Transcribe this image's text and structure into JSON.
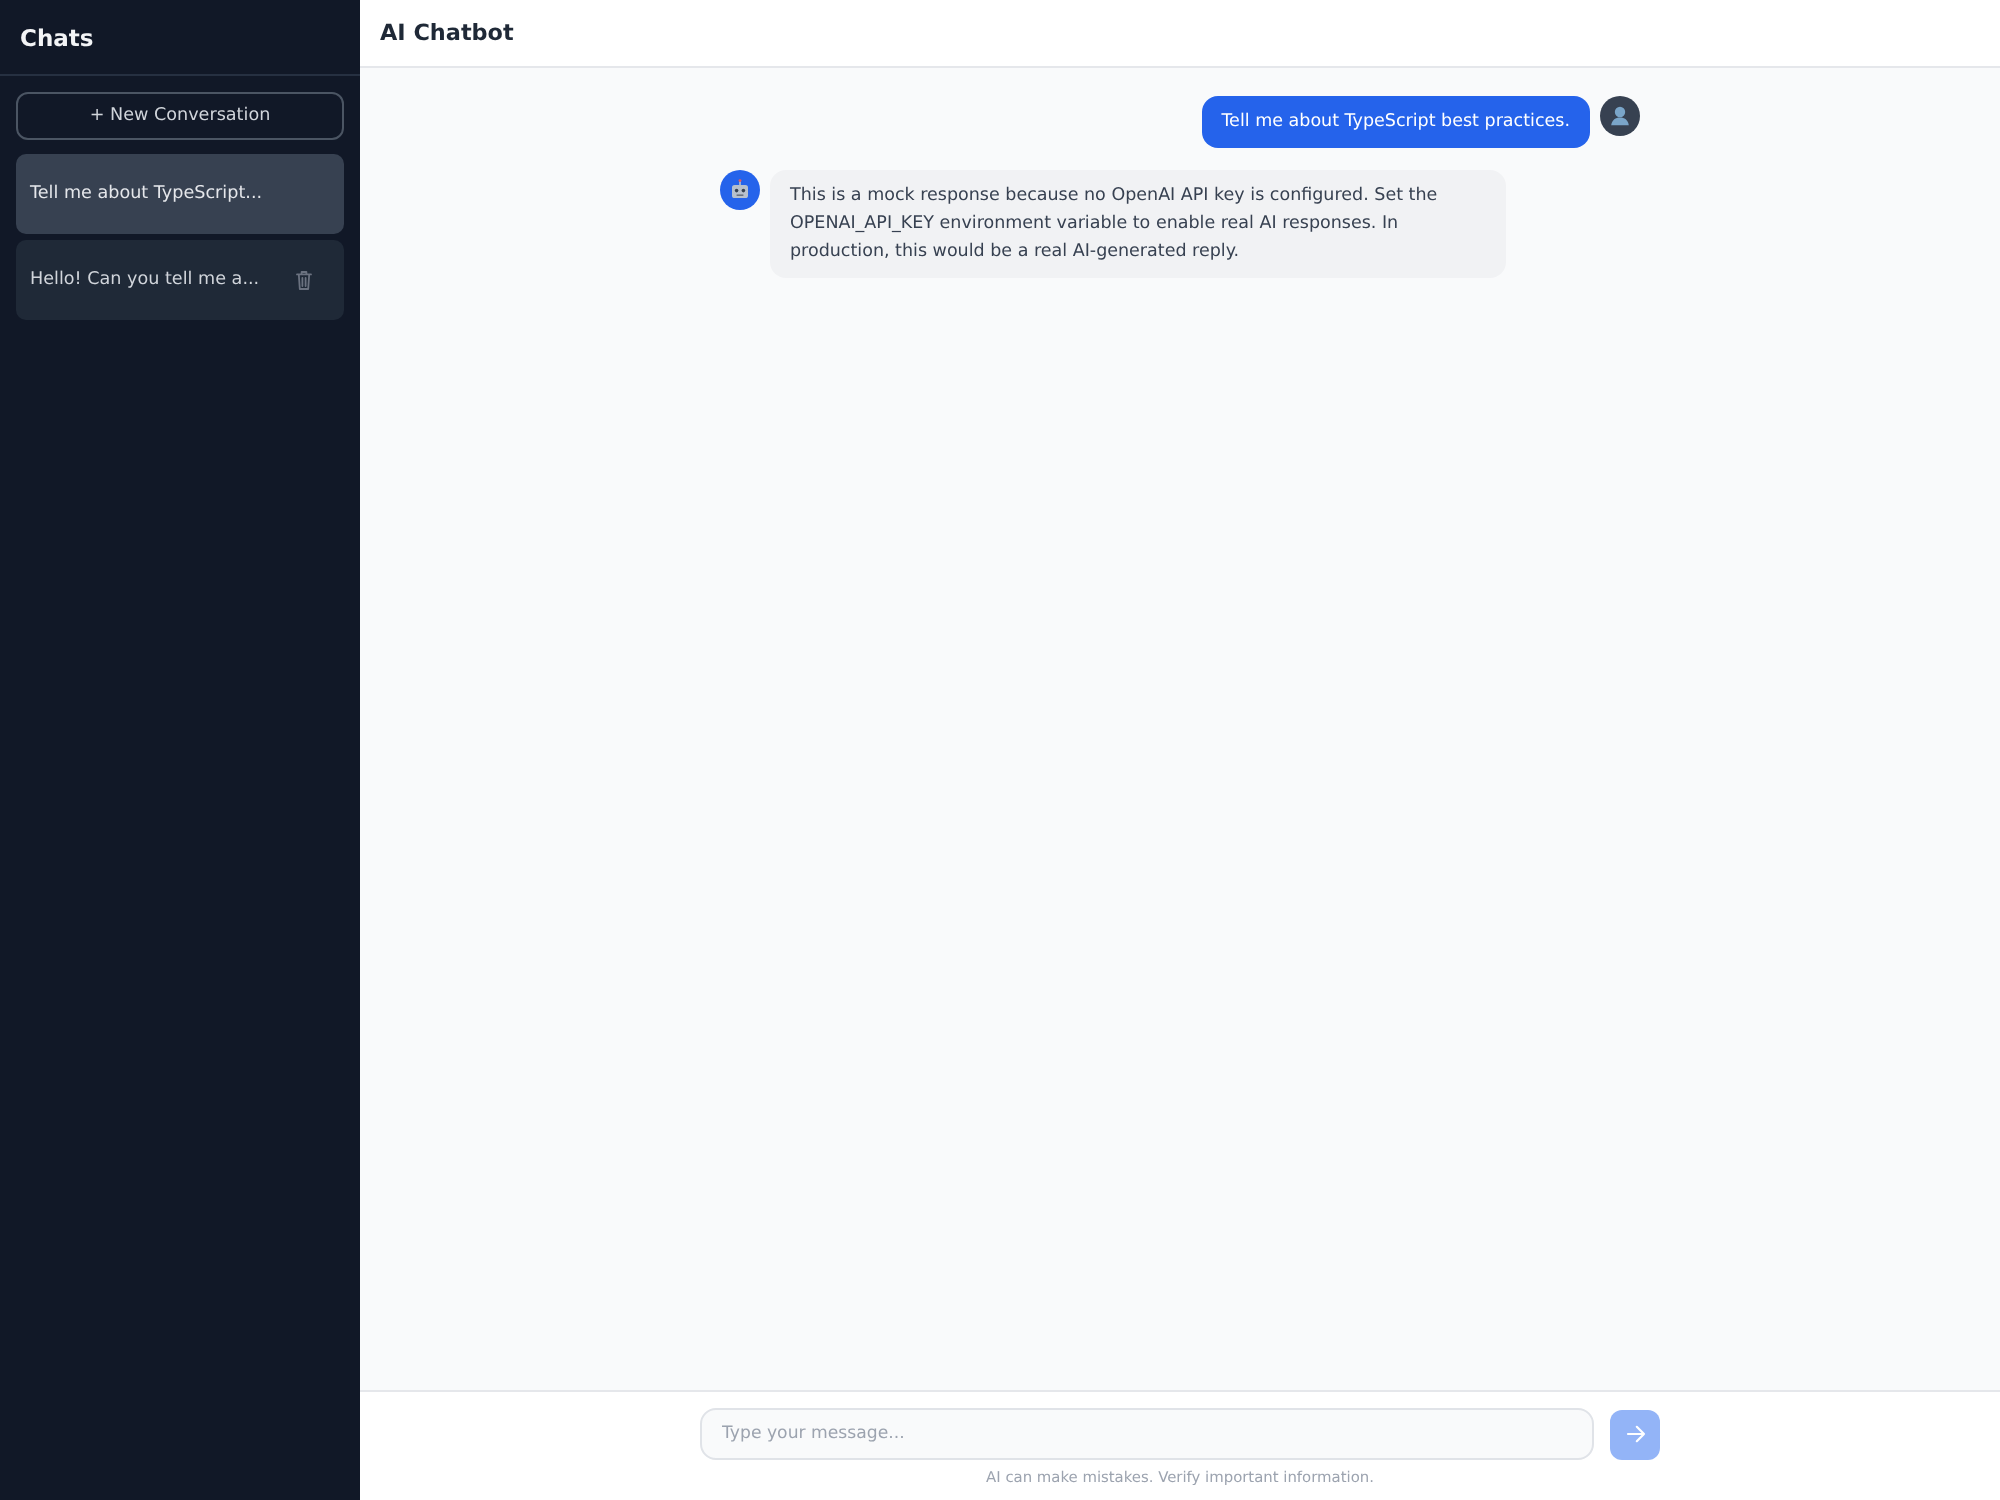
{
  "sidebar": {
    "title": "Chats",
    "new_button": "+ New Conversation",
    "conversations": [
      {
        "title": "Tell me about TypeScript...",
        "selected": true,
        "hovered": false
      },
      {
        "title": "Hello! Can you tell me a...",
        "selected": false,
        "hovered": true
      }
    ]
  },
  "header": {
    "title": "AI Chatbot"
  },
  "messages": [
    {
      "kind": "user",
      "text": "Tell me about TypeScript best practices."
    },
    {
      "kind": "assistant",
      "text": "This is a mock response because no OpenAI API key is configured. Set the OPENAI_API_KEY environment variable to enable real AI responses. In production, this would be a real AI-generated reply."
    }
  ],
  "composer": {
    "placeholder": "Type your message...",
    "send_disabled": true,
    "disclaimer": "AI can make mistakes. Verify important information."
  }
}
